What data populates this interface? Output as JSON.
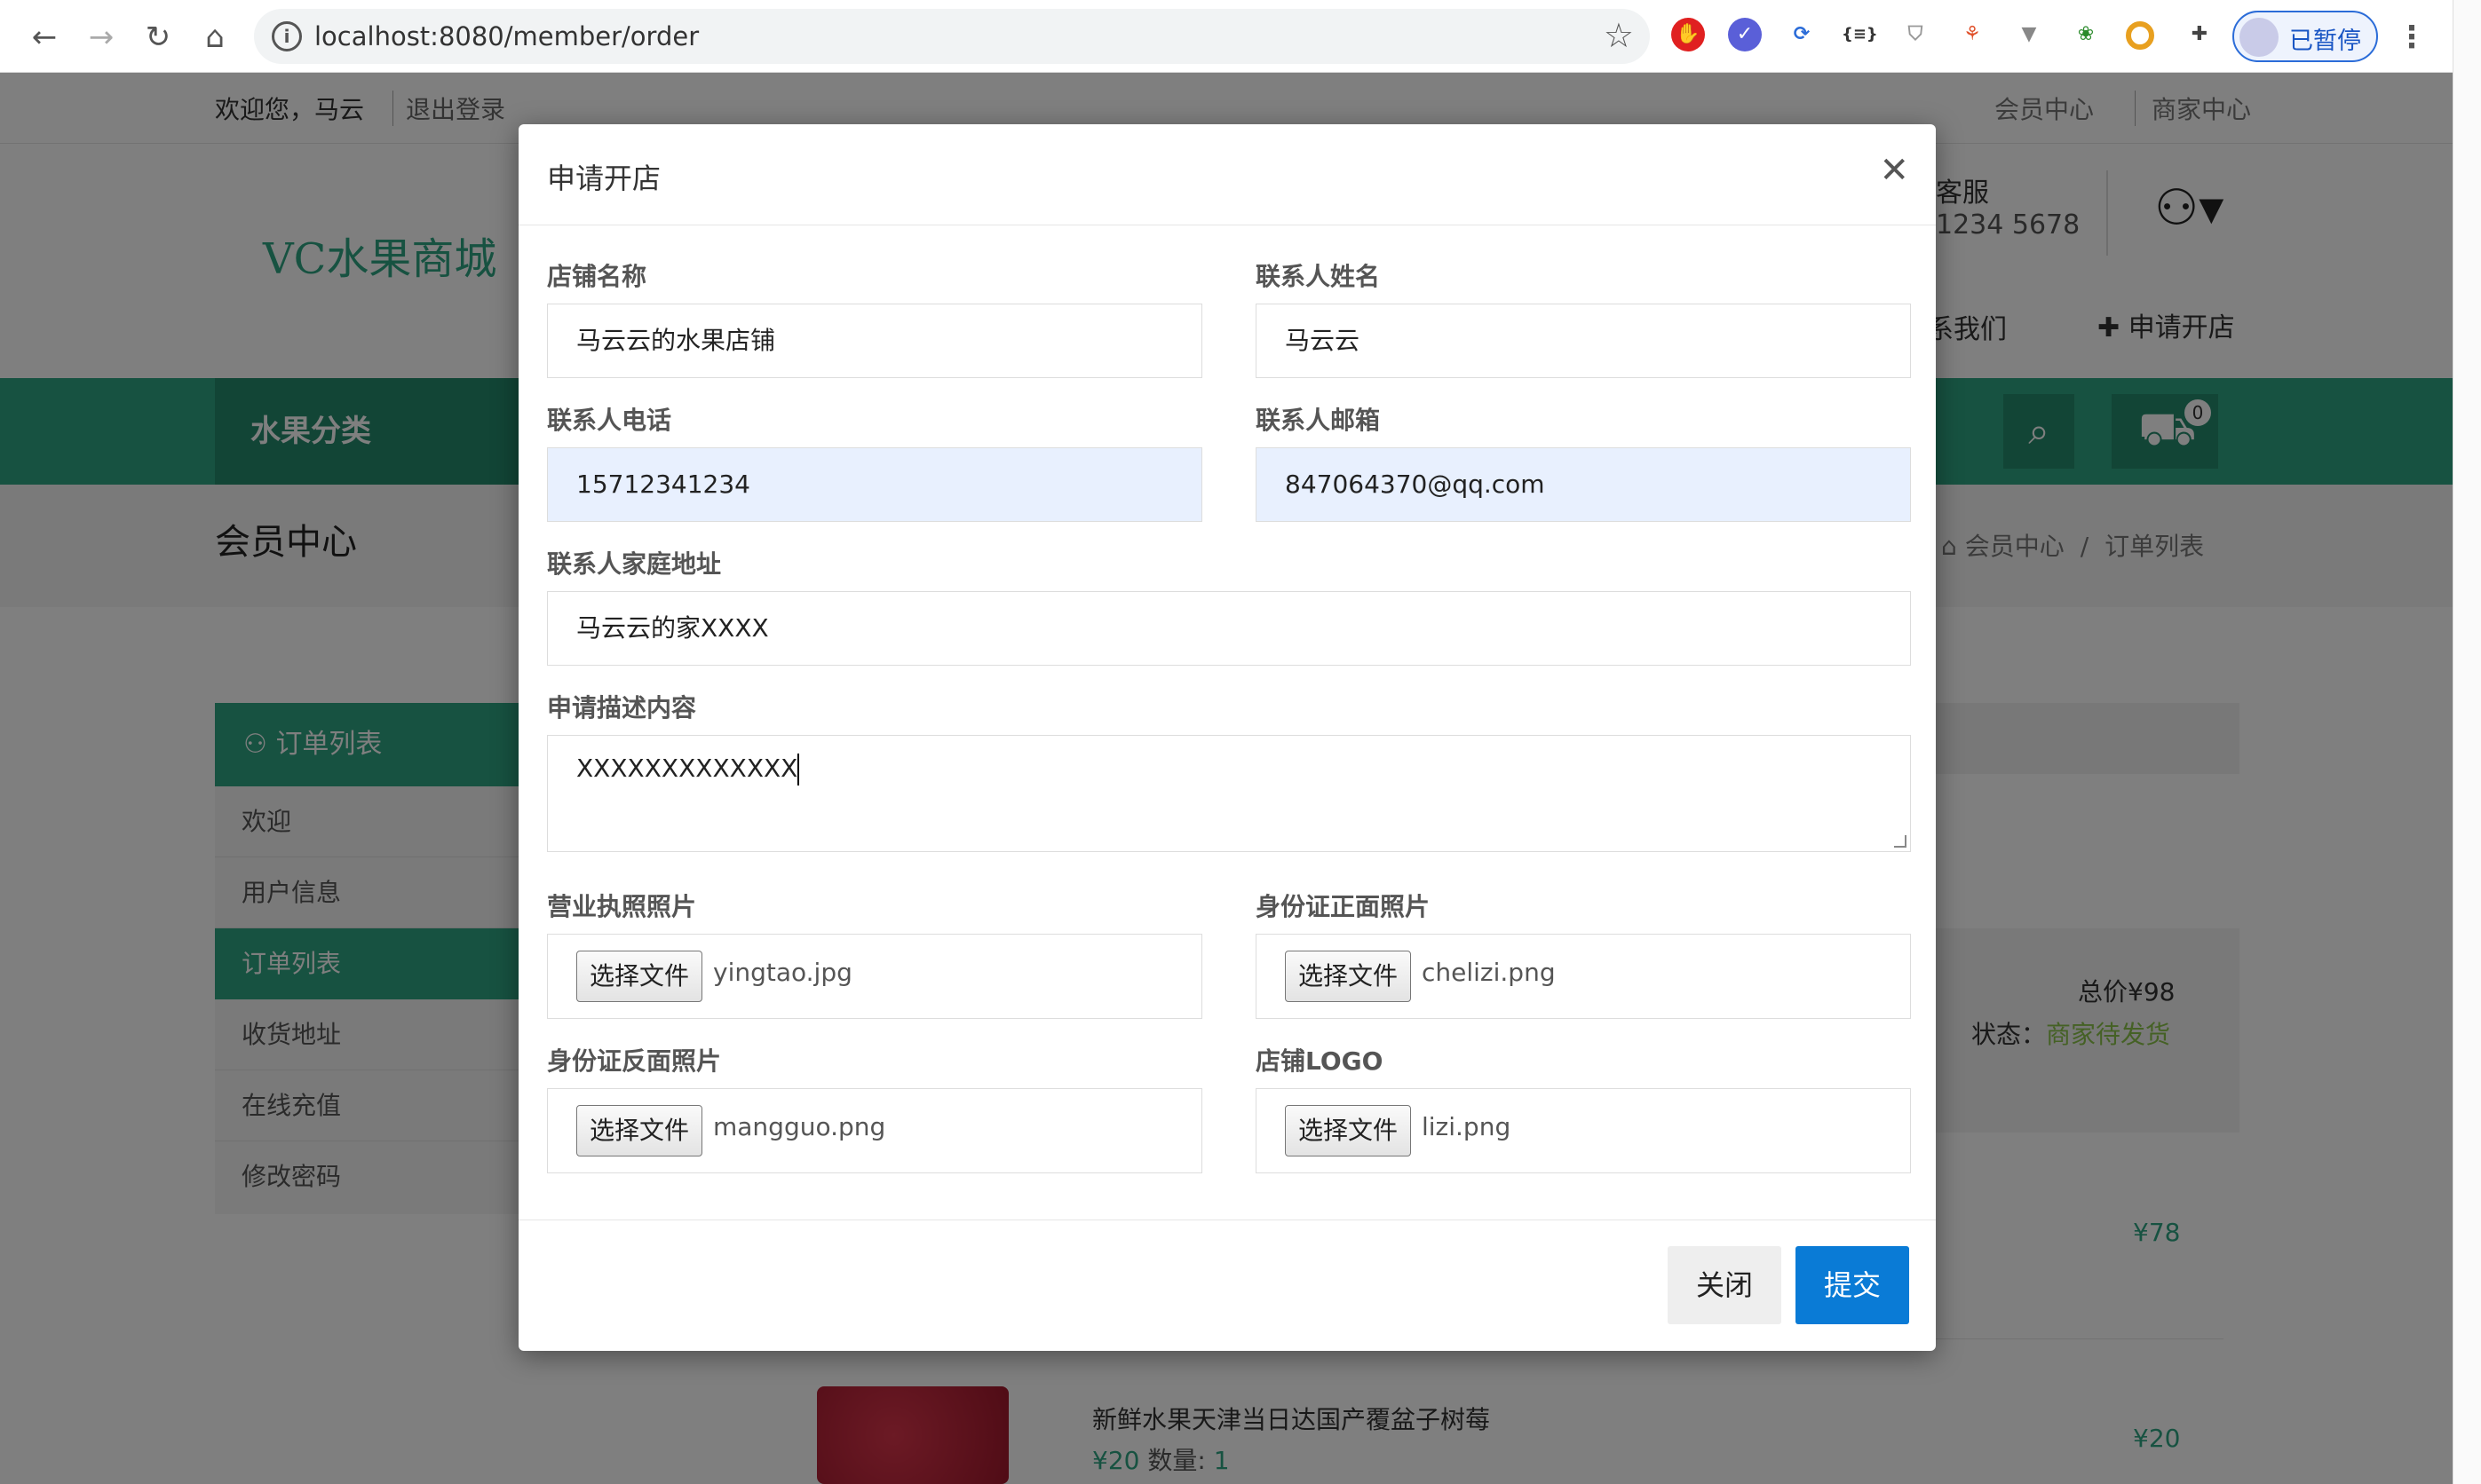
{
  "browser": {
    "url": "localhost:8080/member/order",
    "profile_label": "已暂停"
  },
  "topbar": {
    "greeting": "欢迎您，马云",
    "logout": "退出登录",
    "member_center": "会员中心",
    "merchant_center": "商家中心"
  },
  "header": {
    "logo": "VC水果商城",
    "service_label": "客服",
    "service_phone": "1234 5678",
    "contact": "系我们",
    "apply_shop": "申请开店",
    "cart_count": "0"
  },
  "nav": {
    "category": "水果分类"
  },
  "pagehead": {
    "title": "会员中心",
    "crumb_home": "会员中心",
    "crumb_sep": "/",
    "crumb_current": "订单列表"
  },
  "sidebar": {
    "header": "订单列表",
    "items": [
      {
        "label": "欢迎"
      },
      {
        "label": "用户信息"
      },
      {
        "label": "订单列表"
      },
      {
        "label": "收货地址"
      },
      {
        "label": "在线充值"
      },
      {
        "label": "修改密码"
      }
    ]
  },
  "order": {
    "total": "总价¥98",
    "status_label": "状态：",
    "status": "商家待发货",
    "price1": "¥78",
    "price2": "¥20",
    "item_name": "新鲜水果天津当日达国产覆盆子树莓",
    "item_price": "¥20",
    "qty_label": "数量:",
    "qty": "1"
  },
  "modal": {
    "title": "申请开店",
    "fields": {
      "shop_name_label": "店铺名称",
      "shop_name": "马云云的水果店铺",
      "contact_name_label": "联系人姓名",
      "contact_name": "马云云",
      "phone_label": "联系人电话",
      "phone": "15712341234",
      "email_label": "联系人邮箱",
      "email": "847064370@qq.com",
      "address_label": "联系人家庭地址",
      "address": "马云云的家XXXX",
      "desc_label": "申请描述内容",
      "desc": "XXXXXXXXXXXXX"
    },
    "files": {
      "button": "选择文件",
      "license_label": "营业执照照片",
      "license": "yingtao.jpg",
      "id_front_label": "身份证正面照片",
      "id_front": "chelizi.png",
      "id_back_label": "身份证反面照片",
      "id_back": "mangguo.png",
      "logo_label": "店铺LOGO",
      "logo": "lizi.png"
    },
    "close": "关闭",
    "submit": "提交"
  },
  "colors": {
    "brand": "#2fa583",
    "primary": "#0a7bd6",
    "autofill": "#e8f0fe",
    "status": "#8bc34a"
  }
}
